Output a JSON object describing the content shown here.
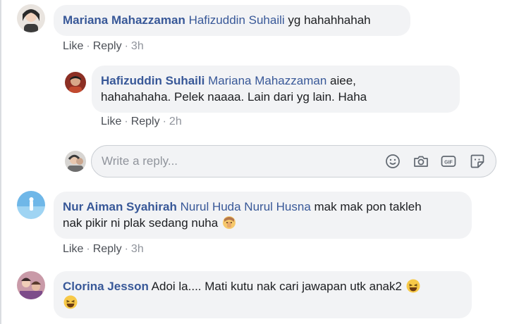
{
  "comments": [
    {
      "author": "Mariana Mahazzaman",
      "tag": "Hafizuddin Suhaili",
      "text": " yg hahahhahah",
      "like": "Like",
      "reply": "Reply",
      "time": "3h"
    },
    {
      "author": "Hafizuddin Suhaili",
      "tag": "Mariana Mahazzaman",
      "text_line1": " aiee,",
      "text_line2": "hahahahaha. Pelek naaaa. Lain dari yg lain. Haha",
      "like": "Like",
      "reply": "Reply",
      "time": "2h"
    },
    {
      "author": "Nur Aiman Syahirah",
      "tag": "Nurul Huda Nurul Husna",
      "text_line1": " mak mak pon takleh",
      "text_line2": "nak pikir ni plak sedang nuha",
      "like": "Like",
      "reply": "Reply",
      "time": "3h"
    },
    {
      "author": "Clorina Jesson",
      "text_line1": " Adoi la.... Mati kutu nak cari jawapan utk anak2"
    }
  ],
  "reply_box": {
    "placeholder": "Write a reply..."
  },
  "icons": {
    "emoji": "smiley-icon",
    "camera": "camera-icon",
    "gif": "gif-icon",
    "sticker": "sticker-icon"
  },
  "colors": {
    "link": "#385898",
    "bubble": "#f2f3f5",
    "meta": "#90949c"
  }
}
